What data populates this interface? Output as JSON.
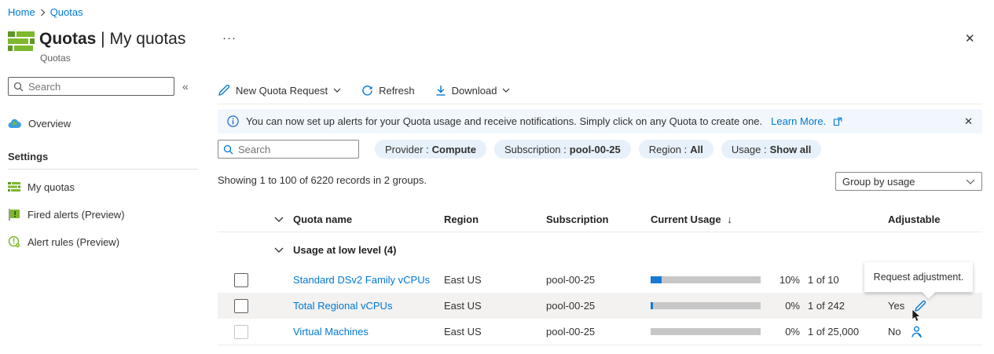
{
  "breadcrumb": {
    "items": [
      {
        "label": "Home"
      },
      {
        "label": "Quotas"
      }
    ]
  },
  "header": {
    "title_primary": "Quotas",
    "title_separator": " | ",
    "title_secondary": "My quotas",
    "subtitle": "Quotas",
    "more_glyph": "···",
    "close_glyph": "✕"
  },
  "sidebar": {
    "search_placeholder": "Search",
    "collapse_glyph": "«",
    "overview_label": "Overview",
    "settings_section": "Settings",
    "my_quotas_label": "My quotas",
    "fired_alerts_label": "Fired alerts (Preview)",
    "alert_rules_label": "Alert rules (Preview)"
  },
  "toolbar": {
    "new_quota_request": "New Quota Request",
    "refresh": "Refresh",
    "download": "Download"
  },
  "banner": {
    "text": "You can now set up alerts for your Quota usage and receive notifications. Simply click on any Quota to create one.",
    "link": "Learn More.",
    "close_glyph": "✕"
  },
  "filters": {
    "search_placeholder": "Search",
    "pills": [
      {
        "label": "Provider :",
        "value": "Compute"
      },
      {
        "label": "Subscription :",
        "value": "pool-00-25"
      },
      {
        "label": "Region :",
        "value": "All"
      },
      {
        "label": "Usage :",
        "value": "Show all"
      }
    ]
  },
  "summary": {
    "text": "Showing 1 to 100 of 6220 records in 2 groups."
  },
  "group_by": {
    "value": "Group by usage"
  },
  "table": {
    "columns": {
      "quota_name": "Quota name",
      "region": "Region",
      "subscription": "Subscription",
      "current_usage": "Current Usage",
      "sort_glyph": "↓",
      "adjustable": "Adjustable"
    },
    "group_label": "Usage at low level (4)",
    "rows": [
      {
        "name": "Standard DSv2 Family vCPUs",
        "region": "East US",
        "subscription": "pool-00-25",
        "usage_pct": "10%",
        "usage_value": 10,
        "usage_count": "1 of 10",
        "adjustable": ""
      },
      {
        "name": "Total Regional vCPUs",
        "region": "East US",
        "subscription": "pool-00-25",
        "usage_pct": "0%",
        "usage_value": 2,
        "usage_count": "1 of 242",
        "adjustable": "Yes"
      },
      {
        "name": "Virtual Machines",
        "region": "East US",
        "subscription": "pool-00-25",
        "usage_pct": "0%",
        "usage_value": 0,
        "usage_count": "1 of 25,000",
        "adjustable": "No"
      }
    ]
  },
  "tooltip": {
    "text": "Request adjustment."
  },
  "colors": {
    "accent": "#0078d4",
    "link": "#0078d4",
    "icon_green": "#7db82d",
    "icon_green_dark": "#5e9624",
    "banner_bg": "#f1f7fd",
    "pill_bg": "#e7f1fb",
    "row_hover_bg": "#f3f2f1",
    "progress_fill": "#1779d1",
    "progress_track": "#c7c7c7"
  }
}
